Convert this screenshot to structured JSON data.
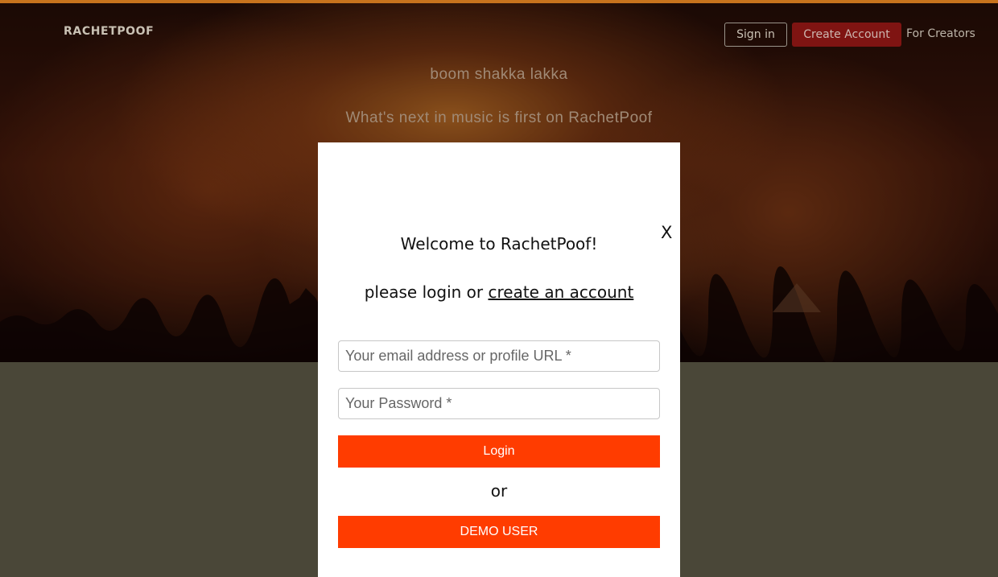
{
  "header": {
    "brand": "RACHETPOOF",
    "sign_in_label": "Sign in",
    "create_account_label": "Create Account",
    "for_creators_label": "For Creators"
  },
  "hero": {
    "tagline_primary": "boom shakka lakka",
    "tagline_secondary": "What's next in music is first on RachetPoof"
  },
  "modal": {
    "close_label": "X",
    "title": "Welcome to RachetPoof!",
    "prompt_prefix": "please login or ",
    "prompt_link": "create an account",
    "email_placeholder": "Your email address or profile URL *",
    "password_placeholder": "Your Password *",
    "login_label": "Login",
    "or_label": "or",
    "demo_label": "DEMO USER"
  },
  "colors": {
    "accent": "#ff3c00",
    "create_account_bg": "#7f1412",
    "top_accent": "#c7731d",
    "page_bg": "#4a4738"
  }
}
